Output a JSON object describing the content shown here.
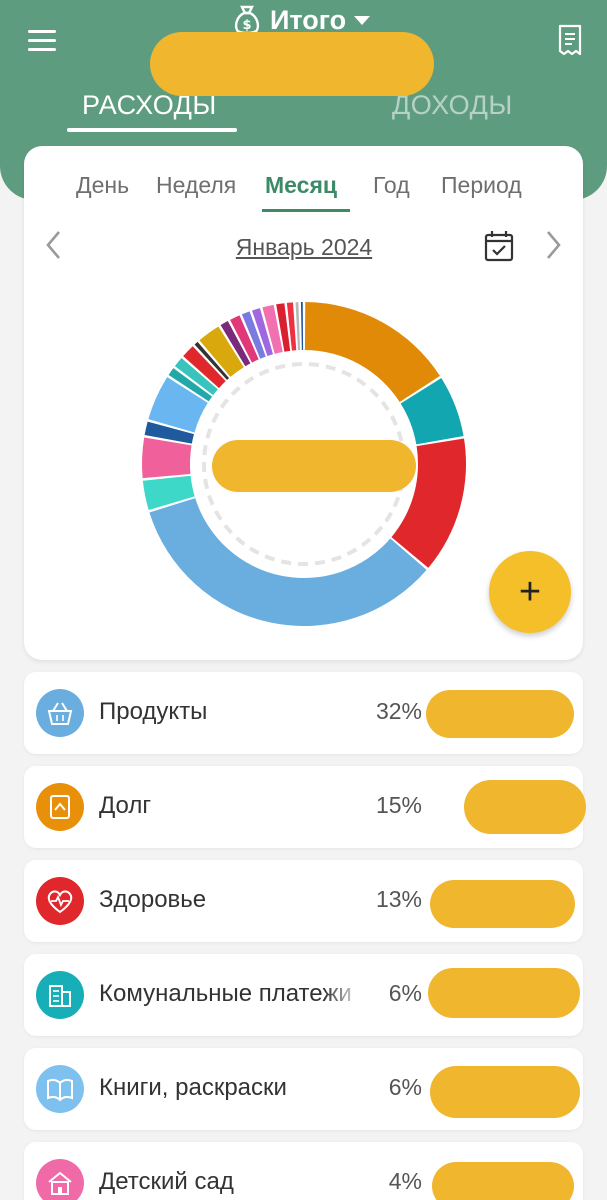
{
  "header": {
    "title": "Итого",
    "tabs": [
      {
        "label": "РАСХОДЫ",
        "active": true
      },
      {
        "label": "ДОХОДЫ",
        "active": false
      }
    ],
    "icons": {
      "menu": "menu-icon",
      "title": "money-bag-icon",
      "receipt": "receipt-icon"
    }
  },
  "periods": {
    "items": [
      "День",
      "Неделя",
      "Месяц",
      "Год",
      "Период"
    ],
    "active": "Месяц"
  },
  "month": {
    "label": "Январь 2024"
  },
  "chart_data": {
    "type": "pie",
    "style": "donut",
    "slices_percent_clockwise_from_top": [
      {
        "color": "#e08a08",
        "value": 15
      },
      {
        "color": "#12a6b0",
        "value": 6
      },
      {
        "color": "#e0282c",
        "value": 13
      },
      {
        "color": "#6aaee0",
        "value": 32
      },
      {
        "color": "#3ed8c8",
        "value": 3
      },
      {
        "color": "#f0609a",
        "value": 4
      },
      {
        "color": "#1f5a9e",
        "value": 1.5
      },
      {
        "color": "#6ab6f0",
        "value": 4.5
      },
      {
        "color": "#22a8a8",
        "value": 1
      },
      {
        "color": "#38c4bc",
        "value": 1.2
      },
      {
        "color": "#e0282c",
        "value": 1.5
      },
      {
        "color": "#333333",
        "value": 0.6
      },
      {
        "color": "#d8a80c",
        "value": 2.4
      },
      {
        "color": "#7a2a7a",
        "value": 1
      },
      {
        "color": "#e03878",
        "value": 1.2
      },
      {
        "color": "#7a7ae0",
        "value": 1
      },
      {
        "color": "#a068e0",
        "value": 1
      },
      {
        "color": "#f070b0",
        "value": 1.3
      },
      {
        "color": "#d82030",
        "value": 1
      },
      {
        "color": "#ee3040",
        "value": 0.8
      },
      {
        "color": "#b8b8b8",
        "value": 0.5
      },
      {
        "color": "#2050a0",
        "value": 0.4
      }
    ]
  },
  "categories": [
    {
      "name": "Продукты",
      "percent": "32%",
      "color": "#6aaee0",
      "icon": "shopping-basket-icon"
    },
    {
      "name": "Долг",
      "percent": "15%",
      "color": "#e8900a",
      "icon": "handshake-icon"
    },
    {
      "name": "Здоровье",
      "percent": "13%",
      "color": "#e0282c",
      "icon": "heart-pulse-icon"
    },
    {
      "name": "Комунальные платежи",
      "percent": "6%",
      "color": "#18aeb8",
      "icon": "building-icon"
    },
    {
      "name": "Книги, раскраски",
      "percent": "6%",
      "color": "#7ec0ee",
      "icon": "open-book-icon"
    },
    {
      "name": "Детский сад",
      "percent": "4%",
      "color": "#f06aa8",
      "icon": "kindergarten-icon"
    }
  ],
  "fab": {
    "label": "+",
    "icon": "plus-icon"
  }
}
